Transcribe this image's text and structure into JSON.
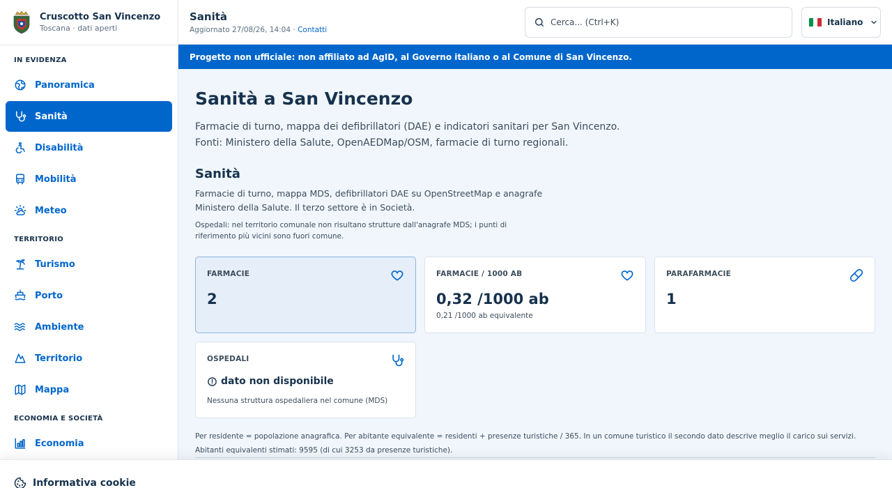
{
  "brand": {
    "title": "Cruscotto San Vincenzo",
    "subtitle": "Toscana · dati aperti"
  },
  "sidebar": {
    "sections": [
      {
        "label": "IN EVIDENZA"
      },
      {
        "label": "TERRITORIO"
      },
      {
        "label": "ECONOMIA E SOCIETÀ"
      }
    ],
    "items": [
      {
        "label": "Panoramica",
        "icon": "globe-icon"
      },
      {
        "label": "Sanità",
        "icon": "stethoscope-icon",
        "active": true
      },
      {
        "label": "Disabilità",
        "icon": "accessibility-icon"
      },
      {
        "label": "Mobilità",
        "icon": "bus-icon"
      },
      {
        "label": "Meteo",
        "icon": "sun-cloud-icon"
      },
      {
        "label": "Turismo",
        "icon": "palm-tree-icon"
      },
      {
        "label": "Porto",
        "icon": "ship-icon"
      },
      {
        "label": "Ambiente",
        "icon": "waves-icon"
      },
      {
        "label": "Territorio",
        "icon": "mountain-icon"
      },
      {
        "label": "Mappa",
        "icon": "map-icon"
      },
      {
        "label": "Economia",
        "icon": "chart-icon"
      }
    ]
  },
  "header": {
    "title": "Sanità",
    "updated": "Aggiornato 27/08/26, 14:04 · ",
    "contacts": "Contatti",
    "search_placeholder": "Cerca... (Ctrl+K)",
    "language": "Italiano"
  },
  "banner": "Progetto non ufficiale: non affiliato ad AgID, al Governo italiano o al Comune di San Vincenzo.",
  "main": {
    "title": "Sanità a San Vincenzo",
    "lead_1": "Farmacie di turno, mappa dei defibrillatori (DAE) e indicatori sanitari per San Vincenzo.",
    "lead_2": "Fonti: Ministero della Salute, OpenAEDMap/OSM, farmacie di turno regionali.",
    "section_title": "Sanità",
    "section_desc": "Farmacie di turno, mappa MDS, defibrillatori DAE su OpenStreetMap e anagrafe Ministero della Salute. Il terzo settore è in Società.",
    "section_note": "Ospedali: nel territorio comunale non risultano strutture dall'anagrafe MDS; i punti di riferimento più vicini sono fuori comune.",
    "cards": [
      {
        "label": "FARMACIE",
        "value": "2",
        "icon": "heart-icon"
      },
      {
        "label": "FARMACIE / 1000 AB",
        "value": "0,32 /1000 ab",
        "sub": "0,21 /1000 ab equivalente",
        "icon": "heart-icon"
      },
      {
        "label": "PARAFARMACIE",
        "value": "1",
        "icon": "pill-icon"
      },
      {
        "label": "OSPEDALI",
        "na": "dato non disponibile",
        "sub": "Nessuna struttura ospedaliera nel comune (MDS)",
        "icon": "stethoscope-icon"
      }
    ],
    "footnote": "Per residente = popolazione anagrafica. Per abitante equivalente = residenti + presenze turistiche / 365. In un comune turistico il secondo dato descrive meglio il carico sui servizi. Abitanti equivalenti stimati: 9595 (di cui 3253 da presenze turistiche)."
  },
  "cookie": {
    "label": "Informativa cookie"
  },
  "colors": {
    "accent": "#0066cc",
    "text": "#17324d",
    "muted": "#5c6f82",
    "main_bg": "#f0f6fc"
  }
}
